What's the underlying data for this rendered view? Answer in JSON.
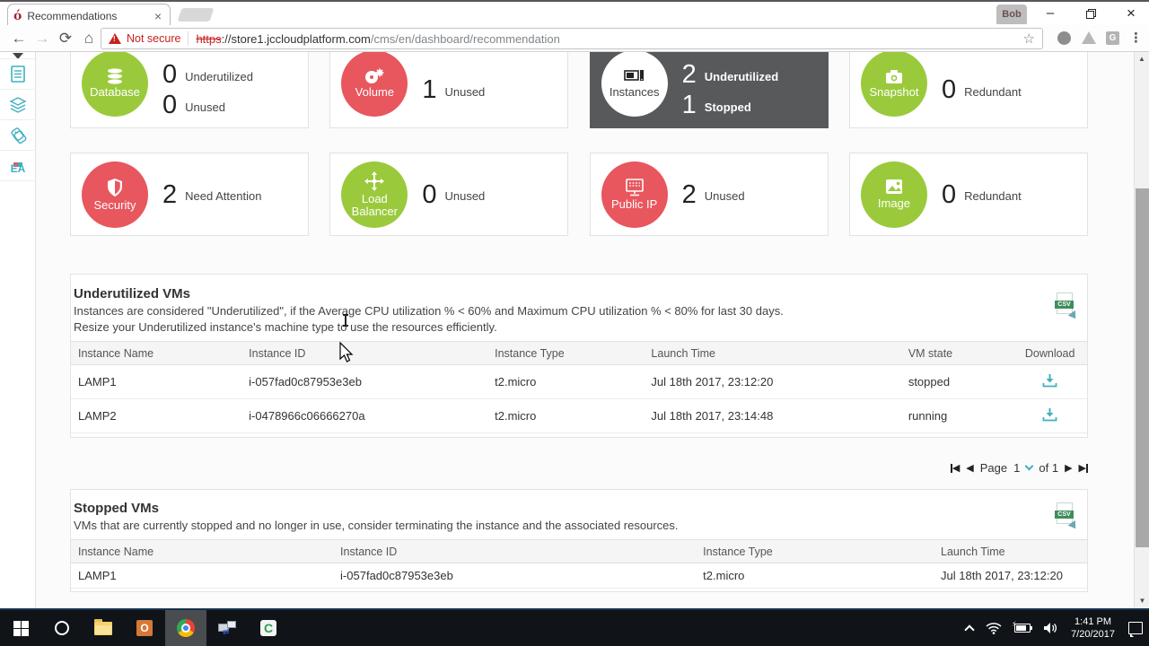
{
  "browser": {
    "tab_title": "Recommendations",
    "profile_name": "Bob",
    "security_label": "Not secure",
    "url_scheme": "https",
    "url_host": "://store1.jccloudplatform.com",
    "url_path": "/cms/en/dashboard/recommendation"
  },
  "glyphs": {
    "favicon": "ó",
    "tab_close": "×",
    "minimize": "–",
    "close": "×",
    "back": "←",
    "forward": "→",
    "reload": "⟳",
    "home": "⌂",
    "warning_mark": "!",
    "star": "☆",
    "ext_g": "G",
    "menu_dots": "⋮",
    "scroll_up": "▲",
    "scroll_down": "▼",
    "prev_tri": "◀",
    "next_tri": "▶",
    "outlook_letter": "O",
    "camtasia_letter": "C",
    "rdp_arrows": "⇄",
    "ea_label": "EA"
  },
  "colors": {
    "green": "#9aca3c",
    "red": "#e8565e",
    "dark_tile": "#58595b",
    "teal": "#41b1c1",
    "not_secure_red": "#c5221f"
  },
  "tiles": [
    {
      "name": "Database",
      "stats": [
        {
          "count": "0",
          "label": "Underutilized"
        },
        {
          "count": "0",
          "label": "Unused"
        }
      ]
    },
    {
      "name": "Volume",
      "stats": [
        {
          "count": "1",
          "label": "Unused"
        }
      ]
    },
    {
      "name": "Instances",
      "stats": [
        {
          "count": "2",
          "label": "Underutilized"
        },
        {
          "count": "1",
          "label": "Stopped"
        }
      ]
    },
    {
      "name": "Snapshot",
      "stats": [
        {
          "count": "0",
          "label": "Redundant"
        }
      ]
    },
    {
      "name": "Security",
      "stats": [
        {
          "count": "2",
          "label": "Need Attention"
        }
      ]
    },
    {
      "name": "Load Balancer",
      "stats": [
        {
          "count": "0",
          "label": "Unused"
        }
      ]
    },
    {
      "name": "Public IP",
      "stats": [
        {
          "count": "2",
          "label": "Unused"
        }
      ]
    },
    {
      "name": "Image",
      "stats": [
        {
          "count": "0",
          "label": "Redundant"
        }
      ]
    }
  ],
  "underutilized": {
    "title": "Underutilized VMs",
    "desc1": "Instances are considered \"Underutilized\", if the Average CPU utilization % < 60% and Maximum CPU utilization % < 80% for last 30 days.",
    "desc2": "Resize your Underutilized instance's machine type to use the resources efficiently.",
    "csv_label": "CSV",
    "headers": [
      "Instance Name",
      "Instance ID",
      "Instance Type",
      "Launch Time",
      "VM state",
      "Download"
    ],
    "rows": [
      {
        "name": "LAMP1",
        "id": "i-057fad0c87953e3eb",
        "type": "t2.micro",
        "launch": "Jul 18th 2017, 23:12:20",
        "state": "stopped"
      },
      {
        "name": "LAMP2",
        "id": "i-0478966c06666270a",
        "type": "t2.micro",
        "launch": "Jul 18th 2017, 23:14:48",
        "state": "running"
      }
    ],
    "pagination": {
      "page_label": "Page",
      "page_number": "1",
      "of_label": "of 1"
    }
  },
  "stopped": {
    "title": "Stopped VMs",
    "desc": "VMs that are currently stopped and no longer in use, consider terminating the instance and the associated resources.",
    "csv_label": "CSV",
    "headers": [
      "Instance Name",
      "Instance ID",
      "Instance Type",
      "Launch Time"
    ],
    "rows": [
      {
        "name": "LAMP1",
        "id": "i-057fad0c87953e3eb",
        "type": "t2.micro",
        "launch": "Jul 18th 2017, 23:12:20"
      }
    ]
  },
  "taskbar": {
    "time": "1:41 PM",
    "date": "7/20/2017"
  }
}
